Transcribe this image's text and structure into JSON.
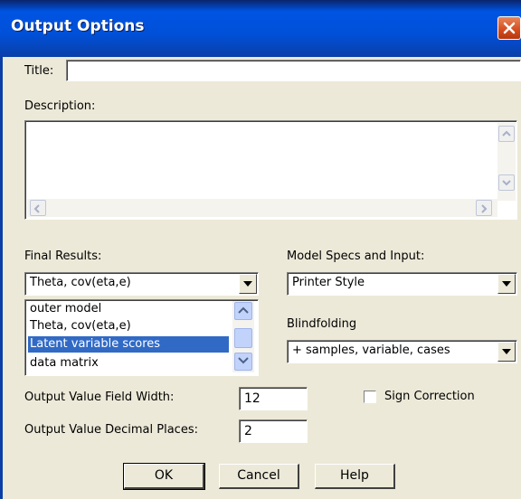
{
  "window": {
    "title": "Output Options"
  },
  "fields": {
    "title_label": "Title:",
    "title_value": "",
    "description_label": "Description:",
    "description_value": ""
  },
  "final_results": {
    "label": "Final Results:",
    "selected": "Theta, cov(eta,e)",
    "list_items": [
      "outer model",
      "Theta, cov(eta,e)",
      "Latent variable scores",
      "data matrix"
    ],
    "highlighted_item": "Latent variable scores"
  },
  "model_specs": {
    "label": "Model Specs and Input:",
    "selected": "Printer Style"
  },
  "blindfolding": {
    "label": "Blindfolding",
    "selected": "+ samples, variable, cases"
  },
  "output_field_width": {
    "label": "Output Value Field Width:",
    "value": "12"
  },
  "output_decimal_places": {
    "label": "Output Value Decimal Places:",
    "value": "2"
  },
  "sign_correction": {
    "label": "Sign Correction",
    "checked": false
  },
  "buttons": {
    "ok": "OK",
    "cancel": "Cancel",
    "help": "Help"
  },
  "icons": [
    "close-icon",
    "scroll-up-icon",
    "scroll-down-icon",
    "scroll-left-icon",
    "scroll-right-icon",
    "dropdown-arrow-icon"
  ],
  "colors": {
    "titlebar": "#0054E3",
    "dialog_bg": "#ECE9D8",
    "selection": "#316AC5",
    "close_button": "#D44B1E"
  }
}
